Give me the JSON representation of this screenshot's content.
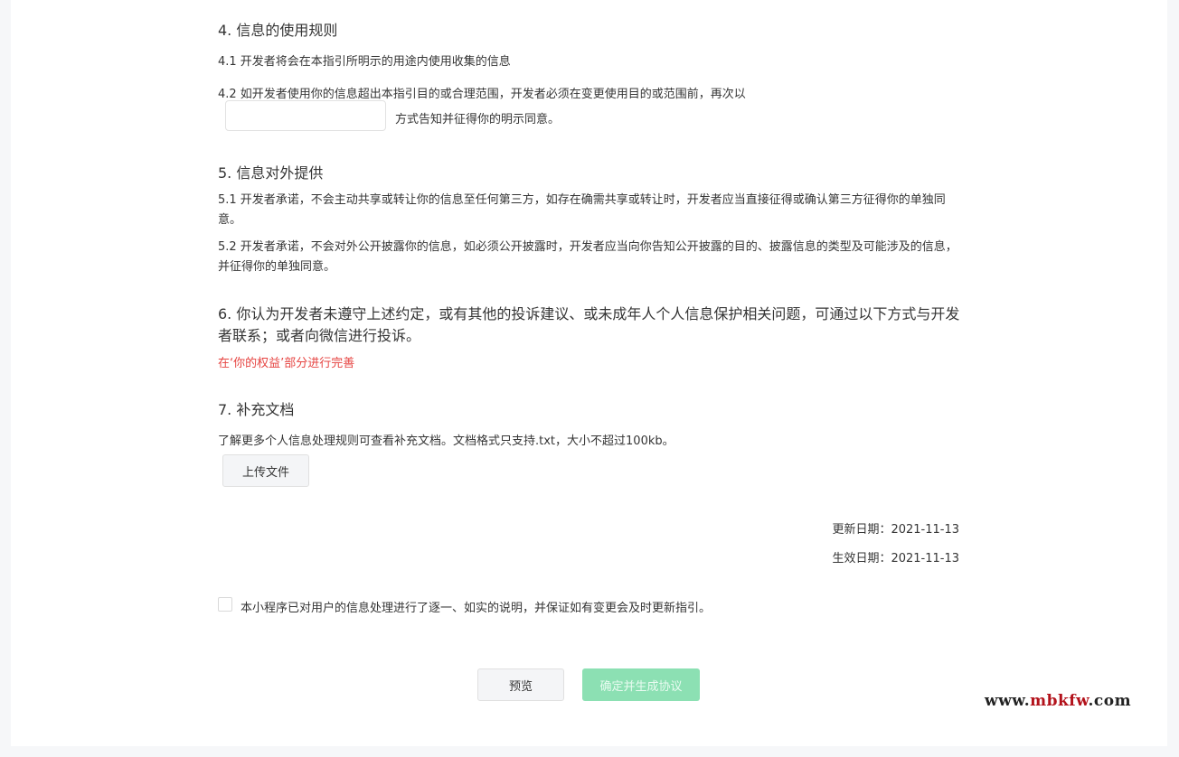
{
  "section4": {
    "title": "4.  信息的使用规则",
    "item1": "4.1   开发者将会在本指引所明示的用途内使用收集的信息",
    "item2_prefix": "4.2   如开发者使用你的信息超出本指引目的或合理范围，开发者必须在变更使用目的或范围前，再次以",
    "item2_input_value": "",
    "item2_suffix": "方式告知并征得你的明示同意。"
  },
  "section5": {
    "title": "5.  信息对外提供",
    "item1": "5.1   开发者承诺，不会主动共享或转让你的信息至任何第三方，如存在确需共享或转让时，开发者应当直接征得或确认第三方征得你的单独同意。",
    "item2": "5.2   开发者承诺，不会对外公开披露你的信息，如必须公开披露时，开发者应当向你告知公开披露的目的、披露信息的类型及可能涉及的信息，并征得你的单独同意。"
  },
  "section6": {
    "title": "6.  你认为开发者未遵守上述约定，或有其他的投诉建议、或未成年人个人信息保护相关问题，可通过以下方式与开发者联系；或者向微信进行投诉。",
    "link": "在‘你的权益’部分进行完善"
  },
  "section7": {
    "title": "7.  补充文档",
    "desc": "了解更多个人信息处理规则可查看补充文档。文档格式只支持.txt，大小不超过100kb。",
    "upload_label": "上传文件"
  },
  "dates": {
    "updated": "更新日期：2021-11-13",
    "effective": "生效日期：2021-11-13"
  },
  "agreement": {
    "checked": false,
    "label": "本小程序已对用户的信息处理进行了逐一、如实的说明，并保证如有变更会及时更新指引。"
  },
  "actions": {
    "preview_label": "预览",
    "confirm_label": "确定并生成协议"
  },
  "watermark": {
    "prefix": "www.",
    "middle": "mbkfw",
    "suffix": ".com"
  },
  "colors": {
    "page_bg": "#f6f7f9",
    "link_red": "#e64340",
    "confirm_green_disabled": "#8ce0b3"
  }
}
